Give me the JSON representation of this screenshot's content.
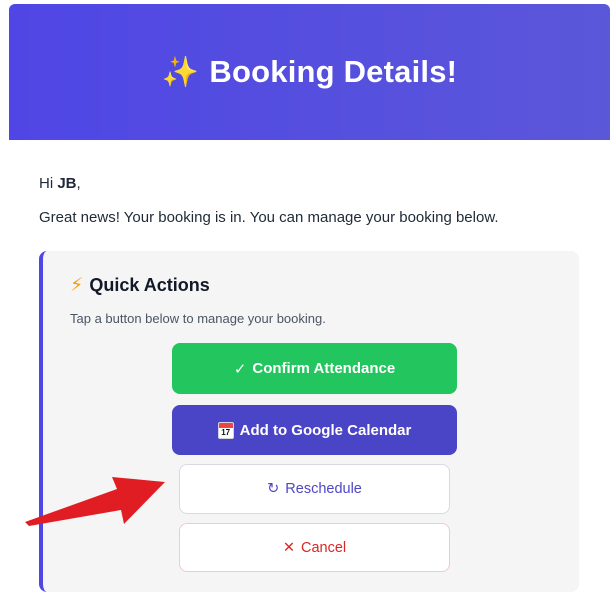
{
  "header": {
    "icon": "sparkles-icon",
    "title": "Booking Details!"
  },
  "greeting": {
    "prefix": "Hi ",
    "name": "JB",
    "suffix": ","
  },
  "intro": "Great news! Your booking is in. You can manage your booking below.",
  "quick_actions": {
    "title": "Quick Actions",
    "icon": "lightning-icon",
    "subtitle": "Tap a button below to manage your booking.",
    "buttons": [
      {
        "icon": "✓",
        "label": "Confirm Attendance"
      },
      {
        "icon": "calendar-icon",
        "calendar_day": "17",
        "label": "Add to Google Calendar"
      },
      {
        "icon": "↻",
        "label": "Reschedule"
      },
      {
        "icon": "✕",
        "label": "Cancel"
      }
    ]
  },
  "colors": {
    "header": "#4f46e5",
    "confirm": "#22c55e",
    "calendar": "#4a44c6",
    "reschedule_text": "#4f46c7",
    "cancel_text": "#dc2626",
    "annotation_arrow": "#e11d24"
  }
}
